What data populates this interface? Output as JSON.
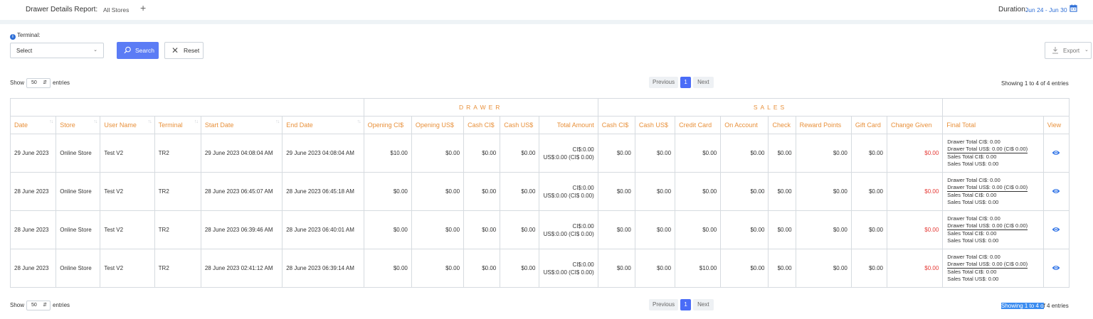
{
  "header": {
    "title": "Drawer Details Report:",
    "stores": "All Stores",
    "add": "+",
    "duration_label": "Duration:",
    "duration_value": "Jun 24 - Jun 30"
  },
  "filters": {
    "terminal_label": "Terminal:",
    "terminal_select": "Select",
    "search_label": "Search",
    "reset_label": "Reset",
    "export_label": "Export"
  },
  "length": {
    "show": "Show",
    "value": "50",
    "entries": "entries"
  },
  "pagination": {
    "previous": "Previous",
    "page": "1",
    "next": "Next"
  },
  "info_top": "Showing 1 to 4 of 4 entries",
  "info_bottom": {
    "selected": "Showing 1 to 4 o",
    "rest": "f 4 entries"
  },
  "table": {
    "groups": {
      "drawer": "DRAWER",
      "sales": "SALES"
    },
    "columns": [
      "Date",
      "Store",
      "User Name",
      "Terminal",
      "Start Date",
      "End Date",
      "Opening CI$",
      "Opening US$",
      "Cash CI$",
      "Cash US$",
      "Total Amount",
      "Cash CI$",
      "Cash US$",
      "Credit Card",
      "On Account",
      "Check",
      "Reward Points",
      "Gift Card",
      "Change Given",
      "Final Total",
      "View"
    ],
    "rows": [
      {
        "date": "29 June 2023",
        "store": "Online Store",
        "user": "Test V2",
        "terminal": "TR2",
        "start": "29 June 2023 04:08:04 AM",
        "end": "29 June 2023 04:08:04 AM",
        "opening_ci": "$10.00",
        "opening_us": "$0.00",
        "cash_ci": "$0.00",
        "cash_us": "$0.00",
        "total_1": "CI$:0.00",
        "total_2": "US$:0.00 (CI$ 0.00)",
        "s_cash_ci": "$0.00",
        "s_cash_us": "$0.00",
        "credit": "$0.00",
        "account": "$0.00",
        "check": "$0.00",
        "reward": "$0.00",
        "gift": "$0.00",
        "change": "$0.00",
        "final_1": "Drawer Total CI$: 0.00",
        "final_2": "Drawer Total US$: 0.00 (CI$ 0.00)",
        "final_3": "Sales Total CI$: 0.00",
        "final_4": "Sales Total US$: 0.00"
      },
      {
        "date": "28 June 2023",
        "store": "Online Store",
        "user": "Test V2",
        "terminal": "TR2",
        "start": "28 June 2023 06:45:07 AM",
        "end": "28 June 2023 06:45:18 AM",
        "opening_ci": "$0.00",
        "opening_us": "$0.00",
        "cash_ci": "$0.00",
        "cash_us": "$0.00",
        "total_1": "CI$:0.00",
        "total_2": "US$:0.00 (CI$ 0.00)",
        "s_cash_ci": "$0.00",
        "s_cash_us": "$0.00",
        "credit": "$0.00",
        "account": "$0.00",
        "check": "$0.00",
        "reward": "$0.00",
        "gift": "$0.00",
        "change": "$0.00",
        "final_1": "Drawer Total CI$: 0.00",
        "final_2": "Drawer Total US$: 0.00 (CI$ 0.00)",
        "final_3": "Sales Total CI$: 0.00",
        "final_4": "Sales Total US$: 0.00"
      },
      {
        "date": "28 June 2023",
        "store": "Online Store",
        "user": "Test V2",
        "terminal": "TR2",
        "start": "28 June 2023 06:39:46 AM",
        "end": "28 June 2023 06:40:01 AM",
        "opening_ci": "$0.00",
        "opening_us": "$0.00",
        "cash_ci": "$0.00",
        "cash_us": "$0.00",
        "total_1": "CI$:0.00",
        "total_2": "US$:0.00 (CI$ 0.00)",
        "s_cash_ci": "$0.00",
        "s_cash_us": "$0.00",
        "credit": "$0.00",
        "account": "$0.00",
        "check": "$0.00",
        "reward": "$0.00",
        "gift": "$0.00",
        "change": "$0.00",
        "final_1": "Drawer Total CI$: 0.00",
        "final_2": "Drawer Total US$: 0.00 (CI$ 0.00)",
        "final_3": "Sales Total CI$: 0.00",
        "final_4": "Sales Total US$: 0.00"
      },
      {
        "date": "28 June 2023",
        "store": "Online Store",
        "user": "Test V2",
        "terminal": "TR2",
        "start": "28 June 2023 02:41:12 AM",
        "end": "28 June 2023 06:39:14 AM",
        "opening_ci": "$0.00",
        "opening_us": "$0.00",
        "cash_ci": "$0.00",
        "cash_us": "$0.00",
        "total_1": "CI$:0.00",
        "total_2": "US$:0.00 (CI$ 0.00)",
        "s_cash_ci": "$0.00",
        "s_cash_us": "$0.00",
        "credit": "$10.00",
        "account": "$0.00",
        "check": "$0.00",
        "reward": "$0.00",
        "gift": "$0.00",
        "change": "$0.00",
        "final_1": "Drawer Total CI$: 0.00",
        "final_2": "Drawer Total US$: 0.00 (CI$ 0.00)",
        "final_3": "Sales Total CI$: 0.00",
        "final_4": "Sales Total US$: 0.00"
      }
    ]
  },
  "colors": {
    "accent": "#4a6cf7",
    "header_orange": "#e8903a",
    "negative_red": "#e53935",
    "link_blue": "#2f6fd6"
  },
  "icons": {
    "calendar": "calendar-icon",
    "search": "search-icon",
    "reset": "close-icon",
    "export": "download-icon",
    "view": "eye-icon",
    "info": "info-icon"
  }
}
